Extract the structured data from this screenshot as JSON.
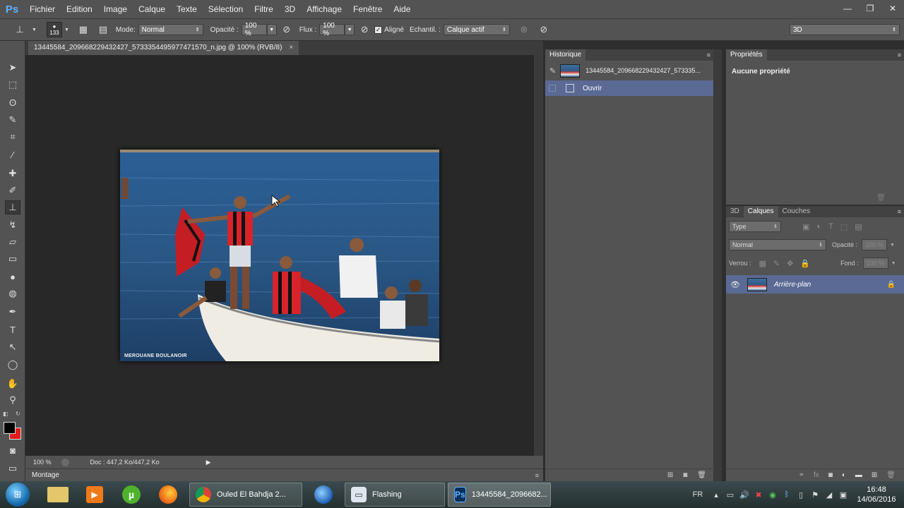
{
  "app": {
    "logo": "Ps"
  },
  "menu": [
    "Fichier",
    "Edition",
    "Image",
    "Calque",
    "Texte",
    "Sélection",
    "Filtre",
    "3D",
    "Affichage",
    "Fenêtre",
    "Aide"
  ],
  "window_controls": {
    "minimize": "—",
    "restore": "❐",
    "close": "✕"
  },
  "options": {
    "brush_size": "133",
    "mode_label": "Mode:",
    "mode_value": "Normal",
    "opacity_label": "Opacité :",
    "opacity_value": "100 %",
    "flux_label": "Flux :",
    "flux_value": "100 %",
    "aligned_label": "Aligné",
    "sample_label": "Echantil. :",
    "sample_value": "Calque actif",
    "workspace_value": "3D"
  },
  "document": {
    "tab_title": "13445584_20966822943​2427_5733354495977471570_n.jpg @ 100% (RVB/8)",
    "tab_close": "×",
    "watermark": "MEROUANE BOULANOIR",
    "zoom": "100 %",
    "doc_info": "Doc : 447,2 Ko/447,2 Ko"
  },
  "mini_bridge": {
    "label": "Montage"
  },
  "history": {
    "tab": "Historique",
    "snapshot_name": "13445584_209668229432427_573335...",
    "steps": [
      "Ouvrir"
    ]
  },
  "properties": {
    "tab": "Propriétés",
    "body": "Aucune propriété"
  },
  "layers": {
    "tabs": [
      "3D",
      "Calques",
      "Couches"
    ],
    "filter_label": "Type",
    "blend_mode": "Normal",
    "opacity_label": "Opacité :",
    "opacity_value": "100 %",
    "lock_label": "Verrou :",
    "fill_label": "Fond :",
    "fill_value": "100 %",
    "items": [
      {
        "name": "Arrière-plan",
        "visible": true,
        "locked": true
      }
    ]
  },
  "taskbar": {
    "apps": [
      {
        "label": "Ouled El Bahdja 2...",
        "icon": "chrome-icon"
      },
      {
        "label": "Flashing",
        "icon": "video-icon"
      },
      {
        "label": "13445584_2096682...",
        "icon": "photoshop-icon"
      }
    ],
    "language": "FR",
    "time": "16:48",
    "date": "14/06/2016"
  },
  "colors": {
    "chrome": "#535353",
    "canvas": "#282828",
    "selection": "#5a6a94",
    "foreground": "#000000",
    "background": "#e31b1b"
  }
}
